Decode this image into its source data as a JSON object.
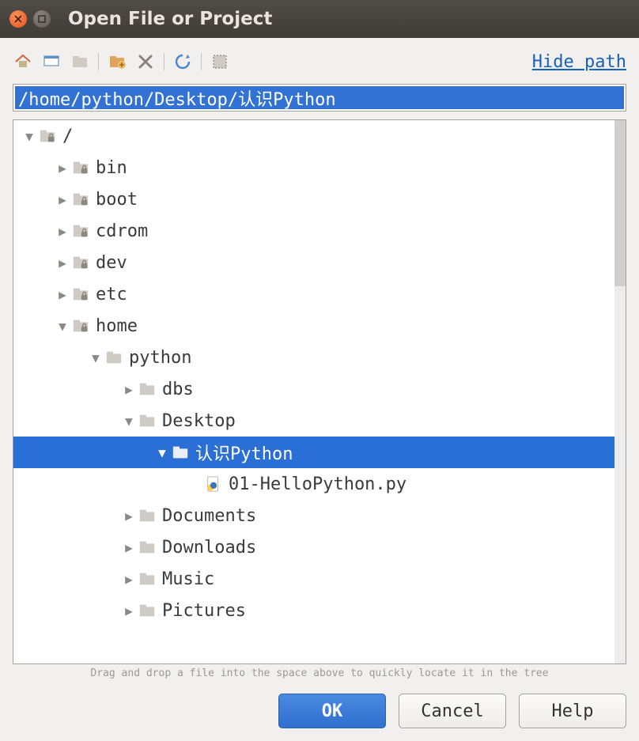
{
  "window": {
    "title": "Open File or Project"
  },
  "toolbar": {
    "hide_path": "Hide path"
  },
  "path_value": "/home/python/Desktop/认识Python",
  "tree": [
    {
      "depth": 0,
      "expander": "down",
      "icon": "folder-lock",
      "label": "/",
      "selected": false
    },
    {
      "depth": 1,
      "expander": "right",
      "icon": "folder-lock",
      "label": "bin",
      "selected": false
    },
    {
      "depth": 1,
      "expander": "right",
      "icon": "folder-lock",
      "label": "boot",
      "selected": false
    },
    {
      "depth": 1,
      "expander": "right",
      "icon": "folder-lock",
      "label": "cdrom",
      "selected": false
    },
    {
      "depth": 1,
      "expander": "right",
      "icon": "folder-lock",
      "label": "dev",
      "selected": false
    },
    {
      "depth": 1,
      "expander": "right",
      "icon": "folder-lock",
      "label": "etc",
      "selected": false
    },
    {
      "depth": 1,
      "expander": "down",
      "icon": "folder-lock",
      "label": "home",
      "selected": false
    },
    {
      "depth": 2,
      "expander": "down",
      "icon": "folder",
      "label": "python",
      "selected": false
    },
    {
      "depth": 3,
      "expander": "right",
      "icon": "folder",
      "label": "dbs",
      "selected": false
    },
    {
      "depth": 3,
      "expander": "down",
      "icon": "folder",
      "label": "Desktop",
      "selected": false
    },
    {
      "depth": 4,
      "expander": "down",
      "icon": "folder",
      "label": "认识Python",
      "selected": true
    },
    {
      "depth": 5,
      "expander": "none",
      "icon": "pyfile",
      "label": "01-HelloPython.py",
      "selected": false
    },
    {
      "depth": 3,
      "expander": "right",
      "icon": "folder",
      "label": "Documents",
      "selected": false
    },
    {
      "depth": 3,
      "expander": "right",
      "icon": "folder",
      "label": "Downloads",
      "selected": false
    },
    {
      "depth": 3,
      "expander": "right",
      "icon": "folder",
      "label": "Music",
      "selected": false
    },
    {
      "depth": 3,
      "expander": "right",
      "icon": "folder",
      "label": "Pictures",
      "selected": false
    }
  ],
  "hint": "Drag and drop a file into the space above to quickly locate it in the tree",
  "buttons": {
    "ok": "OK",
    "cancel": "Cancel",
    "help": "Help"
  }
}
